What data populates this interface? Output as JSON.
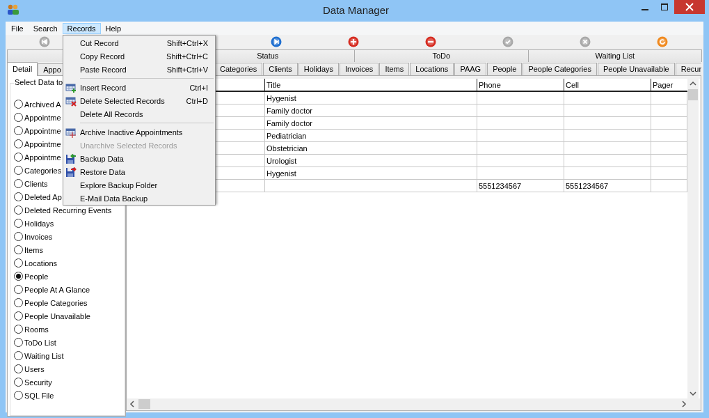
{
  "window": {
    "title": "Data Manager"
  },
  "menubar": [
    {
      "label": "File",
      "selected": false
    },
    {
      "label": "Search",
      "selected": false
    },
    {
      "label": "Records",
      "selected": true
    },
    {
      "label": "Help",
      "selected": false
    }
  ],
  "toolbar": [
    {
      "kind": "first",
      "disabled": true
    },
    {
      "kind": "next",
      "disabled": false
    },
    {
      "kind": "add",
      "disabled": false
    },
    {
      "kind": "remove",
      "disabled": false
    },
    {
      "kind": "confirm",
      "disabled": true
    },
    {
      "kind": "cancel",
      "disabled": true
    },
    {
      "kind": "refresh",
      "disabled": false
    }
  ],
  "top_tabs": [
    {
      "label": "Status",
      "selected": false
    },
    {
      "label": "ToDo",
      "selected": false
    },
    {
      "label": "Waiting List",
      "selected": false
    }
  ],
  "left_tabs": [
    {
      "label": "Detail",
      "selected": true
    },
    {
      "label": "Appo",
      "selected": false
    }
  ],
  "group_label": "Select Data to",
  "data_options": [
    {
      "label": "Archived A",
      "selected": false
    },
    {
      "label": "Appointme",
      "selected": false
    },
    {
      "label": "Appointme",
      "selected": false
    },
    {
      "label": "Appointme",
      "selected": false
    },
    {
      "label": "Appointme",
      "selected": false
    },
    {
      "label": "Categories",
      "selected": false
    },
    {
      "label": "Clients",
      "selected": false
    },
    {
      "label": "Deleted Ap",
      "selected": false
    },
    {
      "label": "Deleted Recurring Events",
      "selected": false
    },
    {
      "label": "Holidays",
      "selected": false
    },
    {
      "label": "Invoices",
      "selected": false
    },
    {
      "label": "Items",
      "selected": false
    },
    {
      "label": "Locations",
      "selected": false
    },
    {
      "label": "People",
      "selected": true
    },
    {
      "label": "People At A Glance",
      "selected": false
    },
    {
      "label": "People Categories",
      "selected": false
    },
    {
      "label": "People Unavailable",
      "selected": false
    },
    {
      "label": "Rooms",
      "selected": false
    },
    {
      "label": "ToDo List",
      "selected": false
    },
    {
      "label": "Waiting List",
      "selected": false
    },
    {
      "label": "Users",
      "selected": false
    },
    {
      "label": "Security",
      "selected": false
    },
    {
      "label": "SQL File",
      "selected": false
    }
  ],
  "table_tabs": [
    {
      "label": "Categories",
      "selected": false
    },
    {
      "label": "Clients",
      "selected": false
    },
    {
      "label": "Holidays",
      "selected": false
    },
    {
      "label": "Invoices",
      "selected": false
    },
    {
      "label": "Items",
      "selected": false
    },
    {
      "label": "Locations",
      "selected": false
    },
    {
      "label": "PAAG",
      "selected": false
    },
    {
      "label": "People",
      "selected": false
    },
    {
      "label": "People Categories",
      "selected": false
    },
    {
      "label": "People Unavailable",
      "selected": false
    },
    {
      "label": "Recur",
      "selected": false
    }
  ],
  "table": {
    "columns": [
      "Title",
      "Phone",
      "Cell",
      "Pager"
    ],
    "rows": [
      [
        "Hygenist",
        "",
        "",
        ""
      ],
      [
        "Family doctor",
        "",
        "",
        ""
      ],
      [
        "Family doctor",
        "",
        "",
        ""
      ],
      [
        "Pediatrician",
        "",
        "",
        ""
      ],
      [
        "Obstetrician",
        "",
        "",
        ""
      ],
      [
        "Urologist",
        "",
        "",
        ""
      ],
      [
        "Hygenist",
        "",
        "",
        ""
      ],
      [
        "",
        "5551234567",
        "5551234567",
        ""
      ]
    ]
  },
  "records_menu": [
    {
      "kind": "item",
      "label": "Cut Record",
      "shortcut": "Shift+Ctrl+X",
      "disabled": false
    },
    {
      "kind": "item",
      "label": "Copy Record",
      "shortcut": "Shift+Ctrl+C",
      "disabled": false
    },
    {
      "kind": "item",
      "label": "Paste Record",
      "shortcut": "Shift+Ctrl+V",
      "disabled": false
    },
    {
      "kind": "separator"
    },
    {
      "kind": "insert",
      "label": "Insert Record",
      "shortcut": "Ctrl+I",
      "disabled": false
    },
    {
      "kind": "delete",
      "label": "Delete Selected Records",
      "shortcut": "Ctrl+D",
      "disabled": false
    },
    {
      "kind": "item",
      "label": "Delete All Records",
      "disabled": false
    },
    {
      "kind": "separator"
    },
    {
      "kind": "archive",
      "label": "Archive Inactive Appointments",
      "disabled": false
    },
    {
      "kind": "item",
      "label": "Unarchive Selected Records",
      "disabled": true
    },
    {
      "kind": "backup",
      "label": "Backup Data",
      "disabled": false
    },
    {
      "kind": "restore",
      "label": "Restore Data",
      "disabled": false
    },
    {
      "kind": "item",
      "label": "Explore Backup Folder",
      "disabled": false
    },
    {
      "kind": "item",
      "label": "E-Mail Data Backup",
      "disabled": false
    }
  ]
}
